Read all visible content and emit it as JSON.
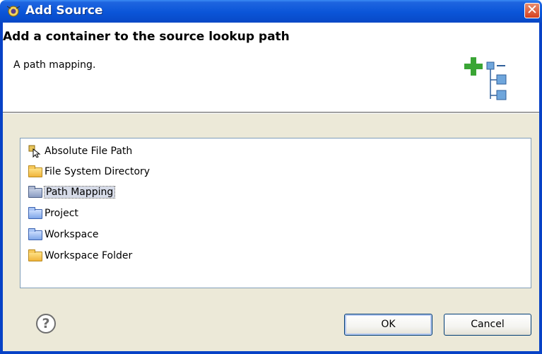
{
  "window": {
    "title": "Add Source",
    "close_label": "✕"
  },
  "header": {
    "title": "Add a container to the source lookup path",
    "description": "A path mapping."
  },
  "list": {
    "items": [
      {
        "label": "Absolute File Path",
        "icon": "file-path-icon"
      },
      {
        "label": "File System Directory",
        "icon": "folder-icon"
      },
      {
        "label": "Path Mapping",
        "icon": "path-mapping-icon",
        "selected": true
      },
      {
        "label": "Project",
        "icon": "project-folder-icon"
      },
      {
        "label": "Workspace",
        "icon": "workspace-folder-icon"
      },
      {
        "label": "Workspace Folder",
        "icon": "folder-icon"
      }
    ]
  },
  "buttons": {
    "help": "?",
    "ok": "OK",
    "cancel": "Cancel"
  },
  "colors": {
    "titlebar": "#0a55d8",
    "dialog_bg": "#ece9d8",
    "selection": "#d6dbe8",
    "add_green": "#3aa535"
  }
}
